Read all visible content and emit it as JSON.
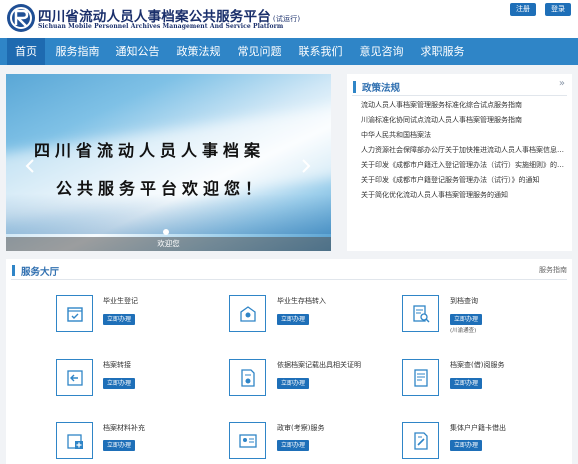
{
  "header": {
    "title": "四川省流动人员人事档案公共服务平台",
    "trial_tag": "(试运行)",
    "subtitle_en": "Sichuan Mobile Personnel Archives Management And Service Platform",
    "register_label": "注册",
    "login_label": "登录",
    "brand_color": "#1a2f6b"
  },
  "nav": {
    "items": [
      {
        "label": "首页",
        "active": true
      },
      {
        "label": "服务指南"
      },
      {
        "label": "通知公告"
      },
      {
        "label": "政策法规"
      },
      {
        "label": "常见问题"
      },
      {
        "label": "联系我们"
      },
      {
        "label": "意见咨询"
      },
      {
        "label": "求职服务"
      }
    ],
    "color": "#2f85c7"
  },
  "banner": {
    "line1": "四川省流动人员人事档案",
    "line2": "公共服务平台欢迎您！",
    "caption": "欢迎您",
    "prev_icon": "chevron-left-icon",
    "next_icon": "chevron-right-icon"
  },
  "policy": {
    "title": "政策法规",
    "more": "»",
    "items": [
      "流动人员人事档案管理服务标准化综合试点服务指南",
      "川渝标准化协同试点流动人员人事档案管理服务指南",
      "中华人民共和国档案法",
      "人力资源社会保障部办公厅关于加快推进流动人员人事档案信息化建设的通知",
      "关于印发《成都市户籍迁入登记管理办法（试行）实施细则》的通知",
      "关于印发《成都市户籍登记服务管理办法（试行）》的通知",
      "关于简化优化流动人员人事档案管理服务的通知"
    ]
  },
  "hall": {
    "title": "服务大厅",
    "guide_label": "服务指南",
    "action_label": "立即办理",
    "services": [
      {
        "name": "毕业生登记",
        "icon": "checklist-icon"
      },
      {
        "name": "毕业生存档转入",
        "icon": "transfer-in-icon"
      },
      {
        "name": "到档查询",
        "icon": "document-search-icon",
        "note": "(川渝通查)"
      },
      {
        "name": "档案转接",
        "icon": "transfer-out-icon"
      },
      {
        "name": "依据档案记载出具相关证明",
        "icon": "certificate-icon"
      },
      {
        "name": "档案查(借)阅服务",
        "icon": "archive-lookup-icon"
      },
      {
        "name": "档案材料补充",
        "icon": "material-add-icon"
      },
      {
        "name": "政审(考察)服务",
        "icon": "id-card-icon"
      },
      {
        "name": "集体户户籍卡借出",
        "icon": "household-card-icon"
      }
    ]
  }
}
